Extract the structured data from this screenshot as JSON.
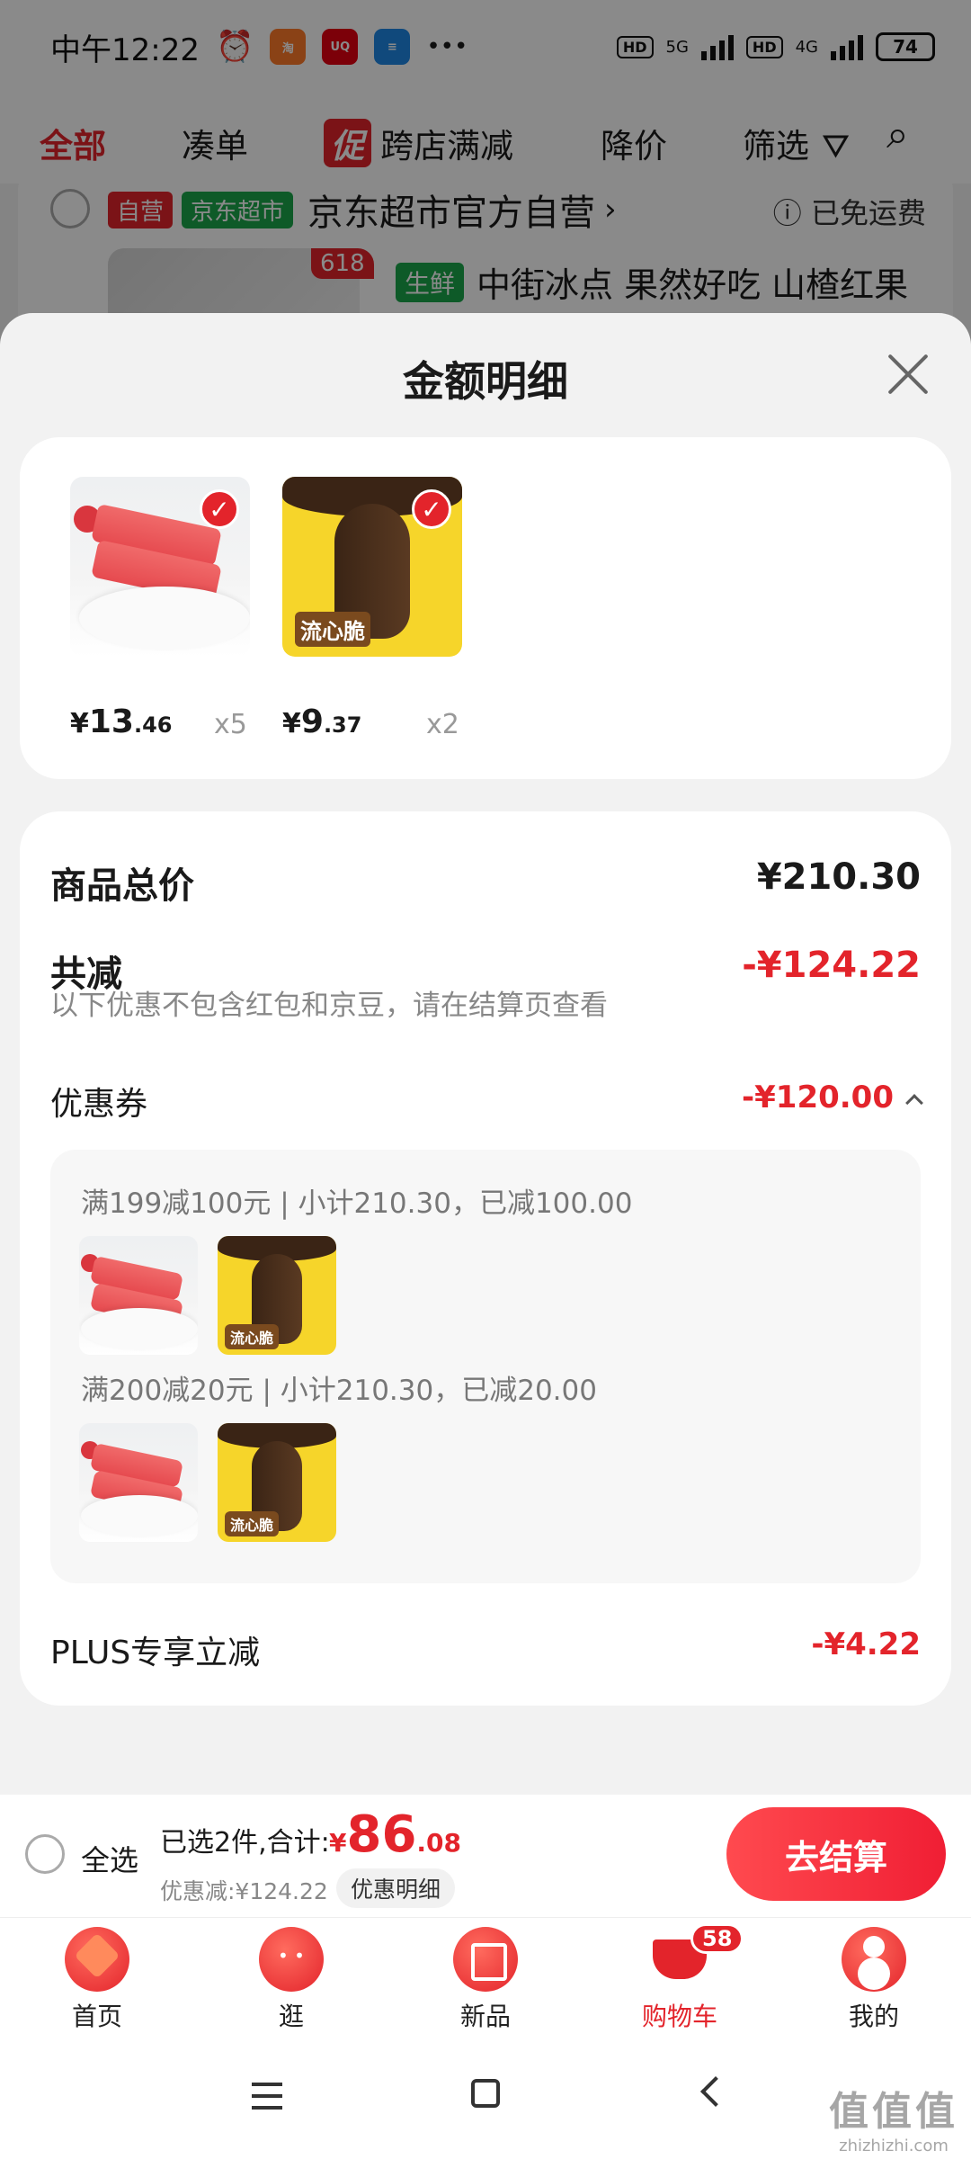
{
  "status_bar": {
    "time": "中午12:22",
    "icons": [
      "alarm-icon",
      "taobao-icon",
      "uniqlo-icon",
      "stack-app-icon"
    ],
    "more": "•••",
    "hd1": "HD",
    "net1": "5G",
    "hd2": "HD",
    "net2": "4G",
    "battery": "74"
  },
  "bg_tabs": {
    "all": "全部",
    "combine": "凑单",
    "promo_badge": "促",
    "cross_store": "跨店满减",
    "price_drop": "降价",
    "filter": "筛选"
  },
  "bg_shop": {
    "tag_self": "自营",
    "tag_market": "京东超市",
    "name": "京东超市官方自营",
    "shipping": "已免运费",
    "badge_618": "618",
    "tag_fresh": "生鲜",
    "product_title": "中街冰点  果然好吃 山楂红果"
  },
  "sheet": {
    "title": "金额明细"
  },
  "products": [
    {
      "price_int": "13",
      "price_dec": ".46",
      "qty": "x5",
      "color": "#e9585d"
    },
    {
      "price_int": "9",
      "price_dec": ".37",
      "qty": "x2",
      "color": "#f6d52a",
      "label": "流心脆"
    }
  ],
  "currency": "¥",
  "detail": {
    "total_label": "商品总价",
    "total_value": "¥210.30",
    "reduce_label": "共减",
    "reduce_value": "-¥124.22",
    "note": "以下优惠不包含红包和京豆，请在结算页查看",
    "coupon_label": "优惠券",
    "coupon_value": "-¥120.00",
    "coupon_lines": [
      "满199减100元 | 小计210.30，已减100.00",
      "满200减20元 | 小计210.30，已减20.00"
    ],
    "plus_label": "PLUS专享立减",
    "plus_value": "-¥4.22"
  },
  "checkout": {
    "select_all": "全选",
    "selected_text": "已选2件,合计:",
    "total_int": "86",
    "total_dec": ".08",
    "discount_text": "优惠减:¥124.22",
    "detail_button": "优惠明细",
    "pay_button": "去结算"
  },
  "tabbar": {
    "items": [
      {
        "label": "首页",
        "icon": "home-icon"
      },
      {
        "label": "逛",
        "icon": "browse-icon"
      },
      {
        "label": "新品",
        "icon": "new-products-icon"
      },
      {
        "label": "购物车",
        "icon": "cart-icon"
      },
      {
        "label": "我的",
        "icon": "profile-icon"
      }
    ],
    "cart_badge": "58",
    "active": 3
  },
  "watermark": {
    "mark": "值值值",
    "url": "zhizhizhi.com"
  },
  "colors": {
    "accent_red": "#e3242b",
    "jd_green": "#1aa64b"
  }
}
